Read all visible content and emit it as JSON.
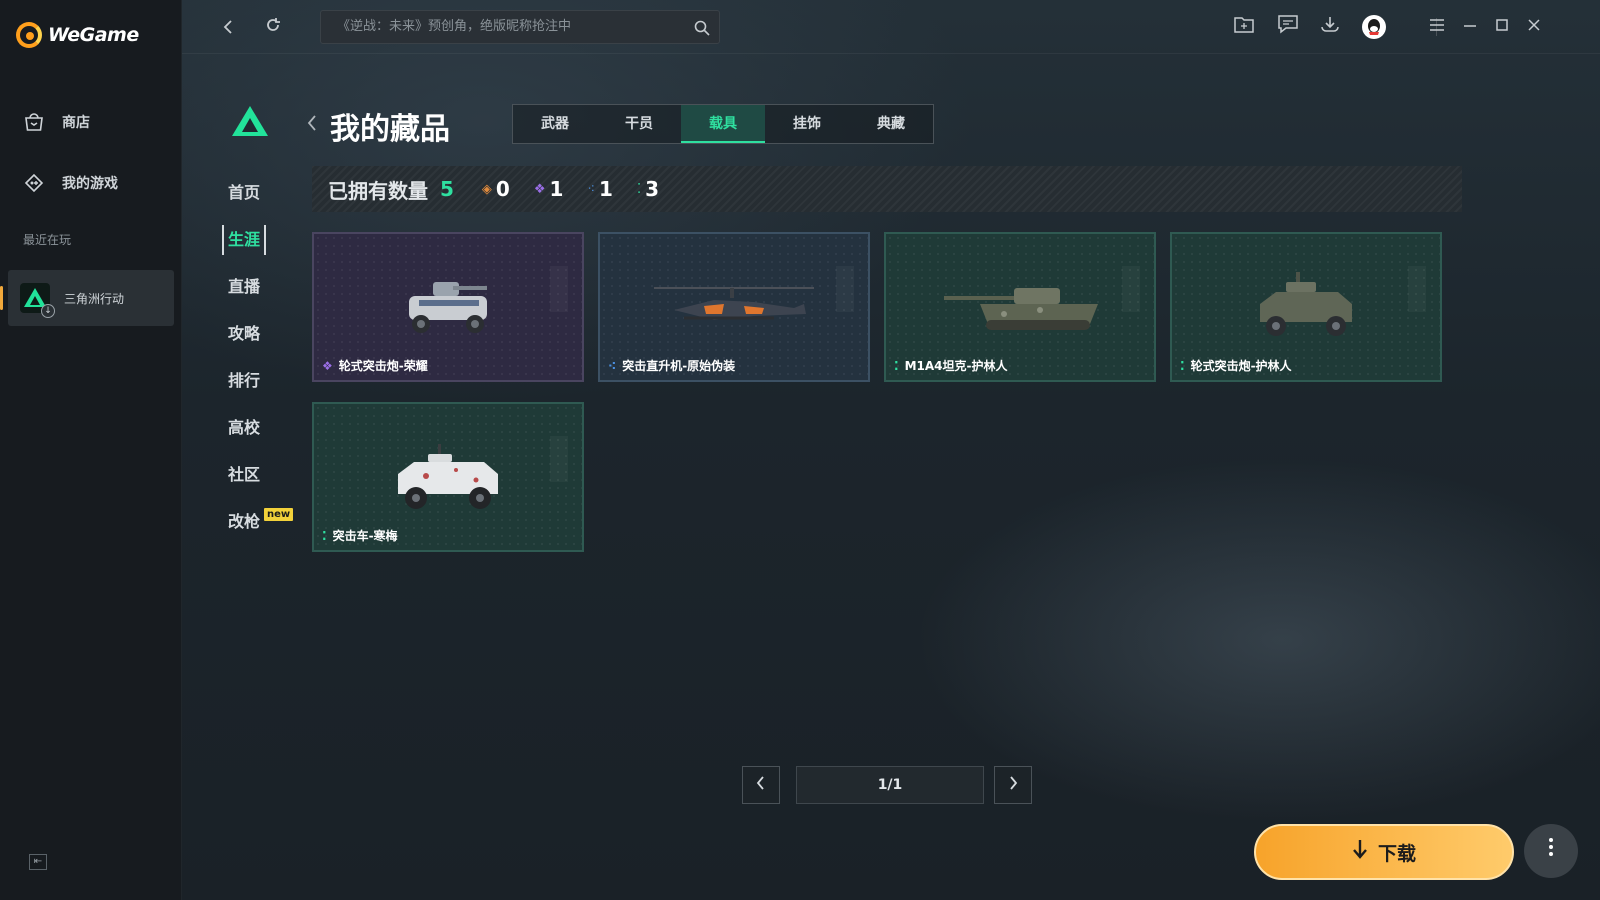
{
  "app": {
    "name": "WeGame"
  },
  "sidebar": {
    "items": [
      {
        "label": "商店",
        "icon": "store-icon"
      },
      {
        "label": "我的游戏",
        "icon": "my-games-icon"
      }
    ],
    "recent_label": "最近在玩",
    "recent_game": {
      "name": "三角洲行动"
    }
  },
  "topbar": {
    "search_placeholder": "《逆战：未来》预创角，绝版昵称抢注中"
  },
  "game_nav": {
    "items": [
      "首页",
      "生涯",
      "直播",
      "攻略",
      "排行",
      "高校",
      "社区",
      "改枪"
    ],
    "active": "生涯",
    "new_badge": "new"
  },
  "collection": {
    "title": "我的藏品",
    "tabs": [
      "武器",
      "干员",
      "载具",
      "挂饰",
      "典藏"
    ],
    "active_tab": "载具",
    "owned_label": "已拥有数量",
    "owned_total": "5",
    "rarity_counts": [
      {
        "color": "#e08a3c",
        "count": "0"
      },
      {
        "color": "#9b6fe8",
        "count": "1"
      },
      {
        "color": "#4a8fe0",
        "count": "1"
      },
      {
        "color": "#2fe0a0",
        "count": "3"
      }
    ],
    "items": [
      {
        "name": "轮式突击炮-荣耀",
        "rarity": "purple",
        "gem_color": "#9b6fe8"
      },
      {
        "name": "突击直升机-原始伪装",
        "rarity": "blue",
        "gem_color": "#4a8fe0"
      },
      {
        "name": "M1A4坦克-护林人",
        "rarity": "green",
        "gem_color": "#2fe0a0"
      },
      {
        "name": "轮式突击炮-护林人",
        "rarity": "green",
        "gem_color": "#2fe0a0"
      },
      {
        "name": "突击车-寒梅",
        "rarity": "green",
        "gem_color": "#2fe0a0"
      }
    ]
  },
  "pagination": {
    "display": "1/1"
  },
  "download": {
    "label": "下载"
  },
  "colors": {
    "accent": "#2fe0a0",
    "download": "#f7a32a",
    "brand": "#ff9f1c"
  }
}
